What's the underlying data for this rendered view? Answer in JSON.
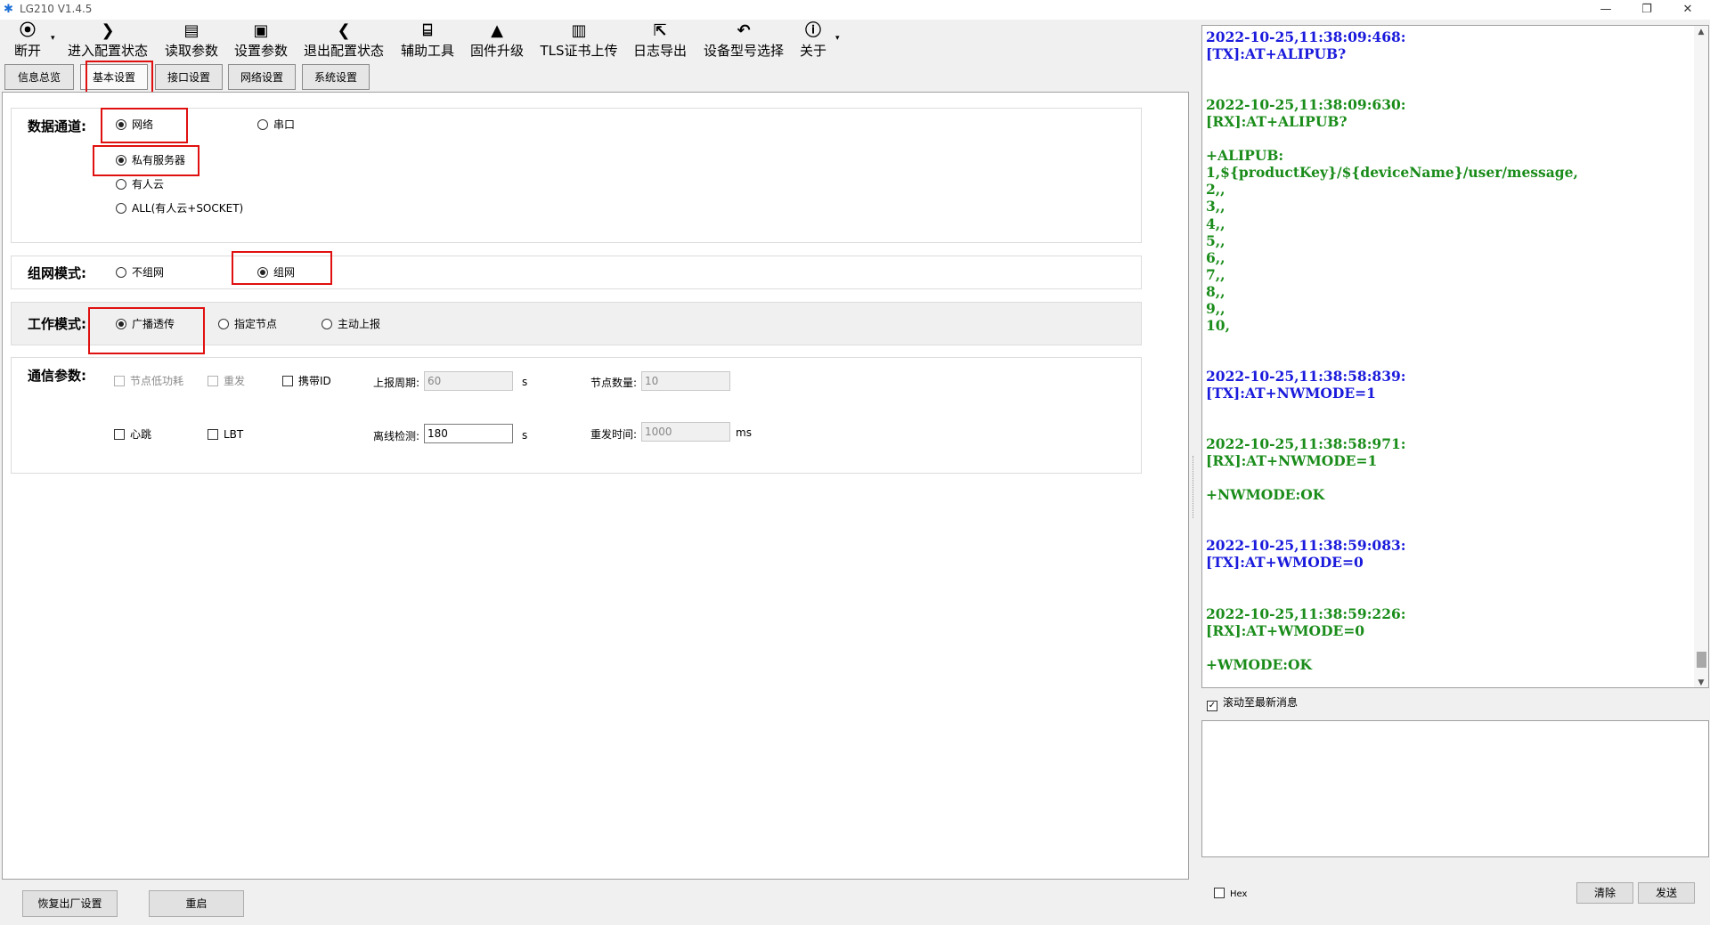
{
  "window": {
    "title": "LG210 V1.4.5",
    "controls": {
      "minimize": "—",
      "restore": "❐",
      "close": "✕"
    }
  },
  "toolbar": {
    "items": [
      {
        "label": "断开",
        "icon": "map-pin-icon",
        "glyph": "⦿"
      },
      {
        "label": "进入配置状态",
        "icon": "chevron-right-icon",
        "glyph": "❯"
      },
      {
        "label": "读取参数",
        "icon": "read-file-icon",
        "glyph": "▤"
      },
      {
        "label": "设置参数",
        "icon": "save-icon",
        "glyph": "▣"
      },
      {
        "label": "退出配置状态",
        "icon": "chevron-left-icon",
        "glyph": "❮"
      },
      {
        "label": "辅助工具",
        "icon": "toolbox-icon",
        "glyph": "⌸"
      },
      {
        "label": "固件升级",
        "icon": "rocket-icon",
        "glyph": "▲"
      },
      {
        "label": "TLS证书上传",
        "icon": "certificate-icon",
        "glyph": "▥"
      },
      {
        "label": "日志导出",
        "icon": "export-icon",
        "glyph": "⇱"
      },
      {
        "label": "设备型号选择",
        "icon": "undo-arrow-icon",
        "glyph": "↶"
      },
      {
        "label": "关于",
        "icon": "info-icon",
        "glyph": "ⓘ"
      }
    ],
    "dropdown_glyph": "▾"
  },
  "tabs": [
    {
      "label": "信息总览",
      "active": false
    },
    {
      "label": "基本设置",
      "active": true
    },
    {
      "label": "接口设置",
      "active": false
    },
    {
      "label": "网络设置",
      "active": false
    },
    {
      "label": "系统设置",
      "active": false
    }
  ],
  "data_channel": {
    "title": "数据通道:",
    "options": [
      {
        "label": "网络",
        "selected": true
      },
      {
        "label": "串口",
        "selected": false
      }
    ],
    "server_options": [
      {
        "label": "私有服务器",
        "selected": true
      },
      {
        "label": "有人云",
        "selected": false
      },
      {
        "label": "ALL(有人云+SOCKET)",
        "selected": false
      }
    ]
  },
  "network_mode": {
    "title": "组网模式:",
    "options": [
      {
        "label": "不组网",
        "selected": false
      },
      {
        "label": "组网",
        "selected": true
      }
    ]
  },
  "work_mode": {
    "title": "工作模式:",
    "options": [
      {
        "label": "广播透传",
        "selected": true
      },
      {
        "label": "指定节点",
        "selected": false
      },
      {
        "label": "主动上报",
        "selected": false
      }
    ]
  },
  "comm_params": {
    "title": "通信参数:",
    "low_power": {
      "label": "节点低功耗",
      "checked": false,
      "enabled": false
    },
    "resend": {
      "label": "重发",
      "checked": false,
      "enabled": false
    },
    "carry_id": {
      "label": "携带ID",
      "checked": false,
      "enabled": true
    },
    "report_period": {
      "label": "上报周期:",
      "value": "60",
      "unit": "s"
    },
    "node_count": {
      "label": "节点数量:",
      "value": "10"
    },
    "heartbeat": {
      "label": "心跳",
      "checked": false,
      "enabled": true
    },
    "lbt": {
      "label": "LBT",
      "checked": false,
      "enabled": true
    },
    "offline_detect": {
      "label": "离线检测:",
      "value": "180",
      "unit": "s"
    },
    "resend_time": {
      "label": "重发时间:",
      "value": "1000",
      "unit": "ms"
    }
  },
  "bottom_buttons": {
    "factory_reset": "恢复出厂设置",
    "restart": "重启"
  },
  "log": {
    "lines": [
      {
        "text": "2022-10-25,11:38:09:468:",
        "kind": "tx"
      },
      {
        "text": "[TX]:AT+ALIPUB?",
        "kind": "tx"
      },
      {
        "text": "",
        "kind": "tx"
      },
      {
        "text": "",
        "kind": "tx"
      },
      {
        "text": "2022-10-25,11:38:09:630:",
        "kind": "rx"
      },
      {
        "text": "[RX]:AT+ALIPUB?",
        "kind": "rx"
      },
      {
        "text": "",
        "kind": "rx"
      },
      {
        "text": "+ALIPUB:",
        "kind": "rx"
      },
      {
        "text": "1,${productKey}/${deviceName}/user/message,",
        "kind": "rx"
      },
      {
        "text": "2,,",
        "kind": "rx"
      },
      {
        "text": "3,,",
        "kind": "rx"
      },
      {
        "text": "4,,",
        "kind": "rx"
      },
      {
        "text": "5,,",
        "kind": "rx"
      },
      {
        "text": "6,,",
        "kind": "rx"
      },
      {
        "text": "7,,",
        "kind": "rx"
      },
      {
        "text": "8,,",
        "kind": "rx"
      },
      {
        "text": "9,,",
        "kind": "rx"
      },
      {
        "text": "10,",
        "kind": "rx"
      },
      {
        "text": "",
        "kind": "rx"
      },
      {
        "text": "",
        "kind": "rx"
      },
      {
        "text": "2022-10-25,11:38:58:839:",
        "kind": "tx"
      },
      {
        "text": "[TX]:AT+NWMODE=1",
        "kind": "tx"
      },
      {
        "text": "",
        "kind": "tx"
      },
      {
        "text": "",
        "kind": "tx"
      },
      {
        "text": "2022-10-25,11:38:58:971:",
        "kind": "rx"
      },
      {
        "text": "[RX]:AT+NWMODE=1",
        "kind": "rx"
      },
      {
        "text": "",
        "kind": "rx"
      },
      {
        "text": "+NWMODE:OK",
        "kind": "rx"
      },
      {
        "text": "",
        "kind": "rx"
      },
      {
        "text": "",
        "kind": "rx"
      },
      {
        "text": "2022-10-25,11:38:59:083:",
        "kind": "tx"
      },
      {
        "text": "[TX]:AT+WMODE=0",
        "kind": "tx"
      },
      {
        "text": "",
        "kind": "tx"
      },
      {
        "text": "",
        "kind": "tx"
      },
      {
        "text": "2022-10-25,11:38:59:226:",
        "kind": "rx"
      },
      {
        "text": "[RX]:AT+WMODE=0",
        "kind": "rx"
      },
      {
        "text": "",
        "kind": "rx"
      },
      {
        "text": "+WMODE:OK",
        "kind": "rx"
      }
    ],
    "colors": {
      "tx": "#1a1adc",
      "rx": "#1a8c1a"
    }
  },
  "scroll_to_latest": {
    "label": "滚动至最新消息",
    "checked": true
  },
  "hex": {
    "label": "Hex",
    "checked": false
  },
  "send_panel": {
    "clear": "清除",
    "send": "发送"
  }
}
